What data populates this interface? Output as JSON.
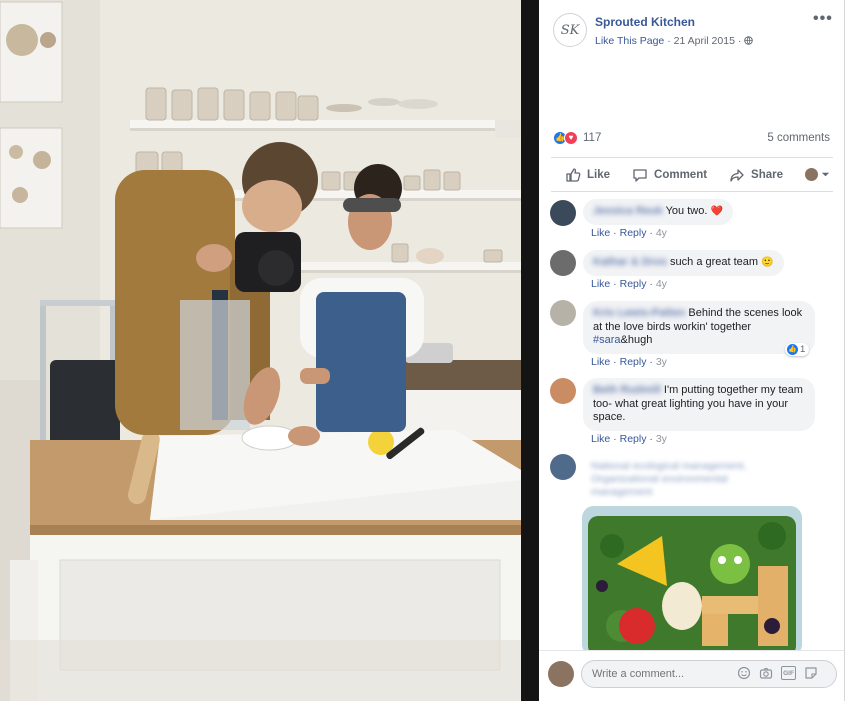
{
  "post": {
    "page_initials": "SK",
    "page_name": "Sprouted Kitchen",
    "like_page": "Like This Page",
    "date": "21 April 2015",
    "privacy_icon": "globe-icon",
    "more_icon": "more-dots-icon"
  },
  "reactions": {
    "icons": [
      "like-reaction-icon",
      "love-reaction-icon"
    ],
    "count": "117",
    "comments_count": "5 comments"
  },
  "actions": {
    "like": "Like",
    "comment": "Comment",
    "share": "Share"
  },
  "comments": [
    {
      "author": "Jessica Reuk",
      "text": "You two.",
      "emoji": "❤️",
      "like": "Like",
      "reply": "Reply",
      "time": "4y"
    },
    {
      "author": "Kathar & Dros",
      "text": "such a great team",
      "emoji": "🙂",
      "like": "Like",
      "reply": "Reply",
      "time": "4y"
    },
    {
      "author": "Kris Lewis-Patten",
      "text_line1": "Behind the scenes look",
      "text_line2": "at the love birds workin' together",
      "hashtag": "#sara",
      "text_end": "&hugh",
      "like": "Like",
      "reply": "Reply",
      "time": "3y",
      "reaction_count": "1"
    },
    {
      "author": "Beth Rudmill",
      "text_line1": "I'm putting together my team",
      "text_line2": "too- what great lighting you have in your",
      "text_line3": "space.",
      "like": "Like",
      "reply": "Reply",
      "time": "3y"
    },
    {
      "author_line1": "National ecological management,",
      "author_line2": "Organizational environmental",
      "author_line3": "management"
    }
  ],
  "composer": {
    "placeholder": "Write a comment...",
    "icons": [
      "emoji-icon",
      "camera-icon",
      "gif-icon",
      "sticker-icon"
    ],
    "gif_label": "GIF"
  },
  "colors": {
    "link": "#385898",
    "bubble": "#f2f3f5",
    "divider": "#141414",
    "like_blue": "#1877f2",
    "love_red": "#f33e58"
  }
}
